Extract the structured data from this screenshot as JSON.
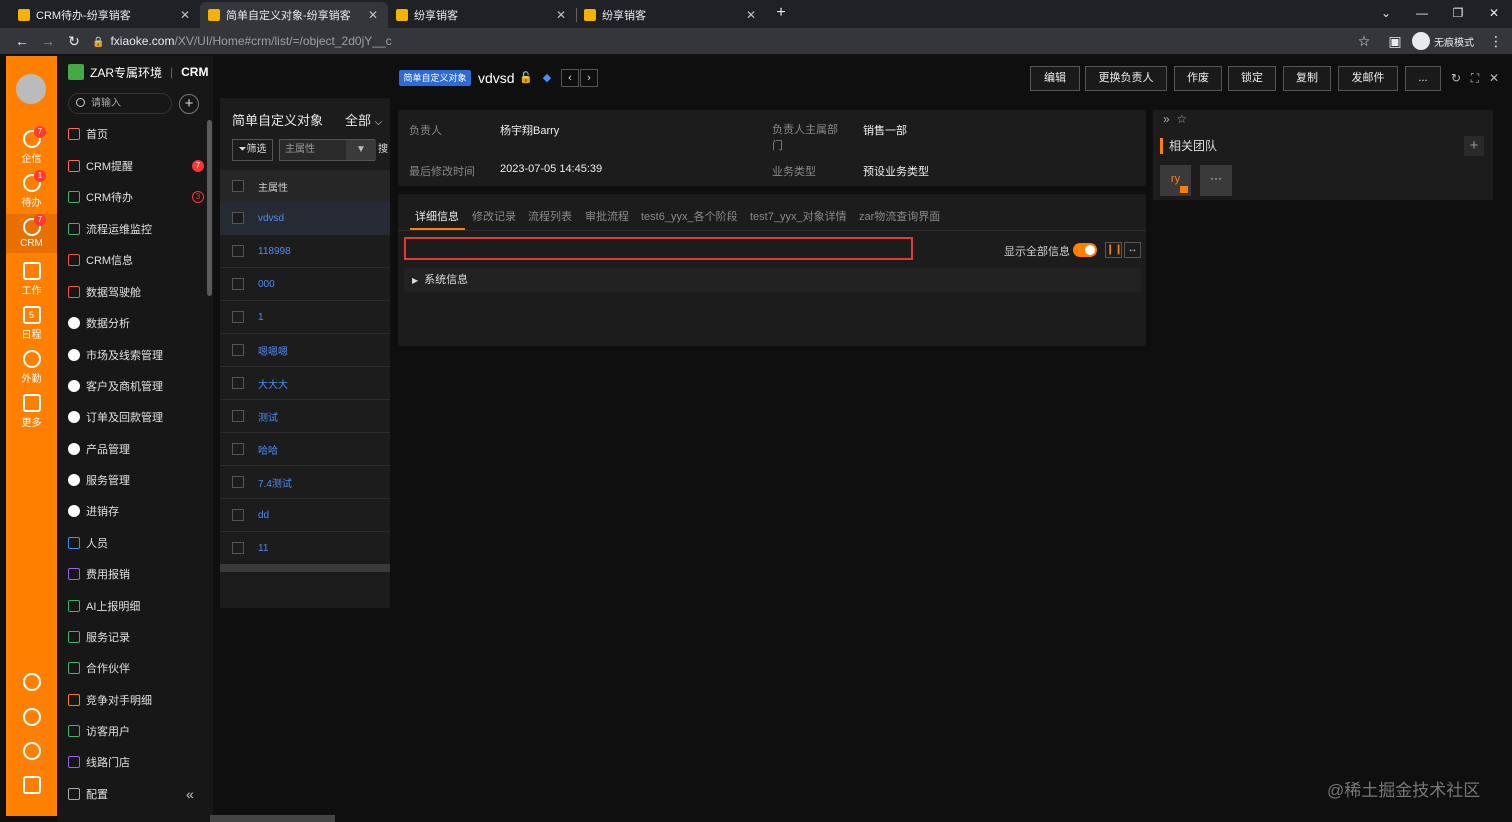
{
  "browser": {
    "tabs": [
      {
        "label": "CRM待办-纷享销客",
        "active": false
      },
      {
        "label": "简单自定义对象-纷享销客",
        "active": true
      },
      {
        "label": "纷享销客",
        "active": false
      },
      {
        "label": "纷享销客",
        "active": false
      }
    ],
    "url_host": "fxiaoke.com",
    "url_path": "/XV/UI/Home#crm/list/=/object_2d0jY__c",
    "incognito_label": "无痕模式",
    "new_tab": "+",
    "window_controls": [
      "⌄",
      "—",
      "❐",
      "✕"
    ]
  },
  "rail": {
    "items": [
      {
        "label": "企信",
        "badge": "7"
      },
      {
        "label": "待办",
        "badge": "1"
      },
      {
        "label": "CRM",
        "badge": "7"
      },
      {
        "label": "工作",
        "badge": ""
      },
      {
        "label": "日程",
        "badge": ""
      },
      {
        "label": "外勤",
        "badge": ""
      },
      {
        "label": "更多",
        "badge": ""
      }
    ],
    "calendar_day": "5"
  },
  "sidebar": {
    "brand": "ZAR专属环境",
    "module": "CRM",
    "search_placeholder": "请输入",
    "items": [
      {
        "label": "首页",
        "badge": "",
        "color": "#ff6b4a"
      },
      {
        "label": "CRM提醒",
        "badge": "7",
        "color": "#ff6b4a"
      },
      {
        "label": "CRM待办",
        "badge": "3",
        "color": "#3db36b"
      },
      {
        "label": "流程运维监控",
        "badge": "",
        "color": "#3db36b"
      },
      {
        "label": "CRM信息",
        "badge": "",
        "color": "#ff4d4d"
      },
      {
        "label": "数据驾驶舱",
        "badge": "",
        "color": "#ff4d4d"
      },
      {
        "label": "数据分析",
        "badge": "",
        "color": "#ffffff"
      },
      {
        "label": "市场及线索管理",
        "badge": "",
        "color": "#ffffff"
      },
      {
        "label": "客户及商机管理",
        "badge": "",
        "color": "#ffffff"
      },
      {
        "label": "订单及回款管理",
        "badge": "",
        "color": "#ffffff"
      },
      {
        "label": "产品管理",
        "badge": "",
        "color": "#ffffff"
      },
      {
        "label": "服务管理",
        "badge": "",
        "color": "#ffffff"
      },
      {
        "label": "进销存",
        "badge": "",
        "color": "#ffffff"
      },
      {
        "label": "人员",
        "badge": "",
        "color": "#4b8df8"
      },
      {
        "label": "费用报销",
        "badge": "",
        "color": "#a45cf5"
      },
      {
        "label": "AI上报明细",
        "badge": "",
        "color": "#3db36b"
      },
      {
        "label": "服务记录",
        "badge": "",
        "color": "#3db36b"
      },
      {
        "label": "合作伙伴",
        "badge": "",
        "color": "#3db36b"
      },
      {
        "label": "竞争对手明细",
        "badge": "",
        "color": "#ff8000"
      },
      {
        "label": "访客用户",
        "badge": "",
        "color": "#3db36b"
      },
      {
        "label": "线路门店",
        "badge": "",
        "color": "#a45cf5"
      },
      {
        "label": "配置",
        "badge": "",
        "color": "#aaaaaa"
      }
    ]
  },
  "list": {
    "title": "简单自定义对象",
    "scope": "全部",
    "filter_label": "筛选",
    "field_select": "主属性",
    "search_label": "搜",
    "column_header": "主属性",
    "rows": [
      "vdvsd",
      "118998",
      "000",
      "1",
      "嗯嗯嗯",
      "大大大",
      "测试",
      "哈哈",
      "7.4测试",
      "dd",
      "11"
    ]
  },
  "detail": {
    "object_tag": "简单自定义对象",
    "name": "vdvsd",
    "actions": [
      "编辑",
      "更换负责人",
      "作废",
      "锁定",
      "复制",
      "发邮件",
      "..."
    ],
    "fields": {
      "owner_label": "负责人",
      "owner_value": "杨宇翔Barry",
      "dept_label": "负责人主属部门",
      "dept_value": "销售一部",
      "modified_label": "最后修改时间",
      "modified_value": "2023-07-05 14:45:39",
      "biztype_label": "业务类型",
      "biztype_value": "预设业务类型"
    },
    "tabs": [
      "详细信息",
      "修改记录",
      "流程列表",
      "审批流程",
      "test6_yyx_各个阶段",
      "test7_yyx_对象详情",
      "zar物流查询界面"
    ],
    "show_all_label": "显示全部信息",
    "show_all_on": true,
    "section": "系统信息"
  },
  "team": {
    "title": "相关团队",
    "member_initials": "ry",
    "more": "···"
  },
  "watermark": "@稀土掘金技术社区",
  "colors": {
    "accent": "#ff8000",
    "link": "#4b8df8",
    "alert": "#e53935"
  }
}
